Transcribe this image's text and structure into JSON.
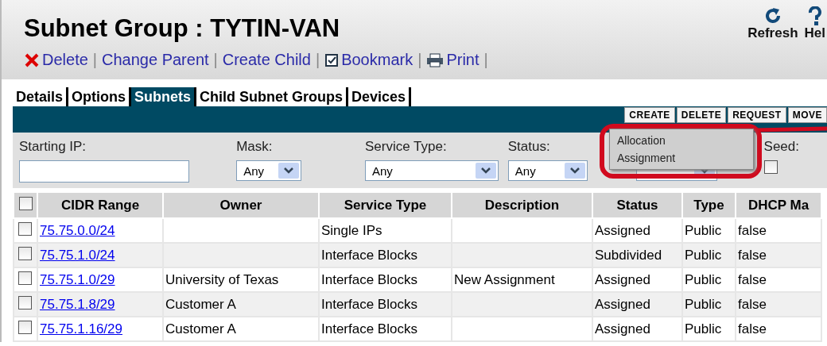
{
  "header": {
    "title": "Subnet Group : TYTIN-VAN",
    "actions": [
      {
        "kind": "delete",
        "label": "Delete",
        "separator": "|"
      },
      {
        "kind": "plain",
        "label": "Change Parent",
        "separator": "|"
      },
      {
        "kind": "plain",
        "label": "Create Child",
        "separator": "|"
      },
      {
        "kind": "bookmark",
        "label": "Bookmark",
        "separator": "|"
      },
      {
        "kind": "print",
        "label": "Print",
        "separator": "|"
      }
    ],
    "tools": [
      {
        "kind": "refresh",
        "label": "Refresh"
      },
      {
        "kind": "help",
        "label": "Hel"
      }
    ]
  },
  "tabs": [
    {
      "label": "Details",
      "selected": false
    },
    {
      "label": "Options",
      "selected": false
    },
    {
      "label": "Subnets",
      "selected": true
    },
    {
      "label": "Child Subnet Groups",
      "selected": false
    },
    {
      "label": "Devices",
      "selected": false
    }
  ],
  "toolbar_buttons": [
    "CREATE",
    "DELETE",
    "REQUEST",
    "MOVE"
  ],
  "menu": [
    "Allocation",
    "Assignment"
  ],
  "filters": [
    {
      "kind": "text",
      "label": "Starting IP:"
    },
    {
      "kind": "select",
      "label": "Mask:",
      "value": "Any"
    },
    {
      "kind": "select",
      "label": "Service Type:",
      "value": "Any"
    },
    {
      "kind": "select",
      "label": "Status:",
      "value": "Any"
    },
    {
      "kind": "select"
    },
    {
      "kind": "checkbox",
      "label": "Seed:",
      "checked": false
    }
  ],
  "table": {
    "all_checked": false,
    "columns": [
      "CIDR Range",
      "Owner",
      "Service Type",
      "Description",
      "Status",
      "Type",
      "DHCP Ma"
    ],
    "rows": [
      {
        "checked": false,
        "cells": [
          "75.75.0.0/24",
          "",
          "Single IPs",
          "",
          "Assigned",
          "Public",
          "false"
        ]
      },
      {
        "checked": false,
        "cells": [
          "75.75.1.0/24",
          "",
          "Interface Blocks",
          "",
          "Subdivided",
          "Public",
          "false"
        ]
      },
      {
        "checked": false,
        "cells": [
          "75.75.1.0/29",
          "University of Texas",
          "Interface Blocks",
          "New Assignment",
          "Assigned",
          "Public",
          "false"
        ]
      },
      {
        "checked": false,
        "cells": [
          "75.75.1.8/29",
          "Customer A",
          "Interface Blocks",
          "",
          "Assigned",
          "Public",
          "false"
        ]
      },
      {
        "checked": false,
        "cells": [
          "75.75.1.16/29",
          "Customer A",
          "Interface Blocks",
          "",
          "Assigned",
          "Public",
          "false"
        ]
      }
    ]
  }
}
